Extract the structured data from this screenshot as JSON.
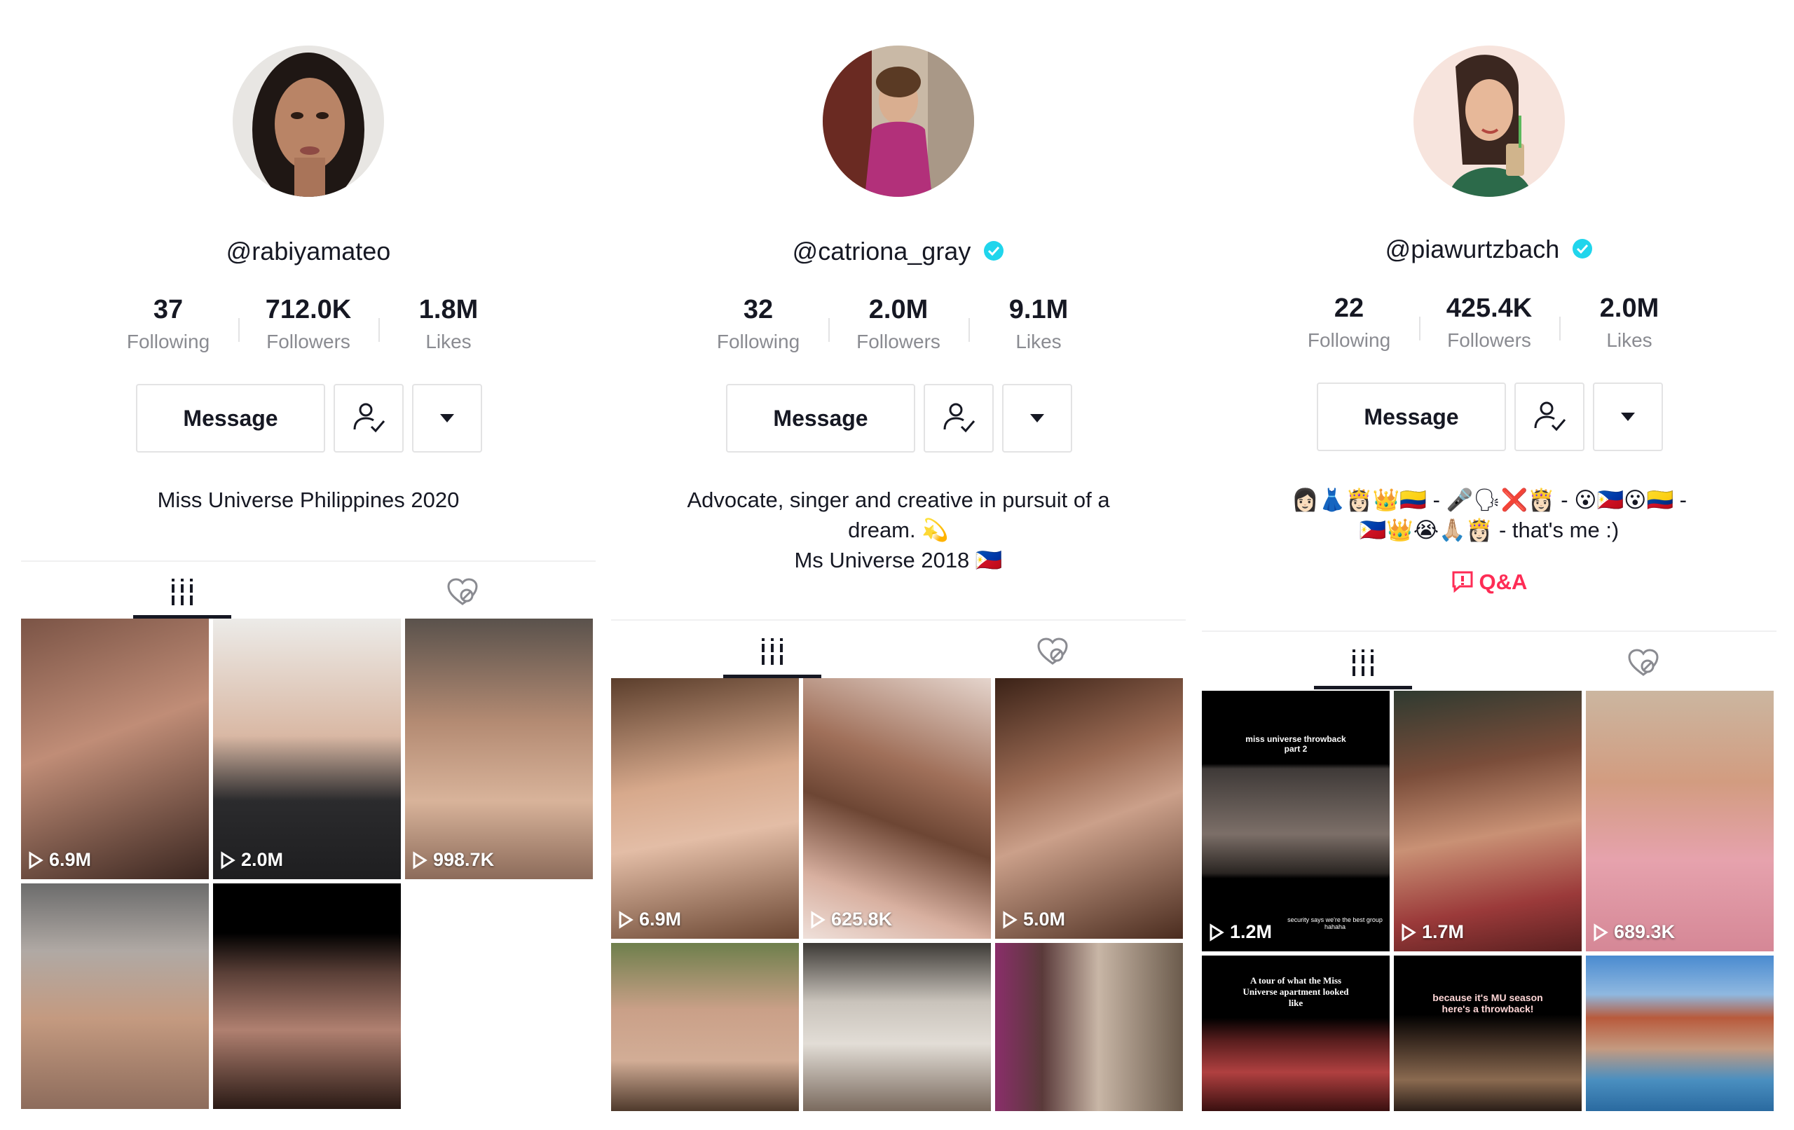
{
  "colors": {
    "text": "#161823",
    "muted": "#8a8b91",
    "accent": "#fe2c55",
    "verified": "#20d5ec"
  },
  "profiles": [
    {
      "handle": "@rabiyamateo",
      "verified": false,
      "stats": [
        {
          "value": "37",
          "label": "Following"
        },
        {
          "value": "712.0K",
          "label": "Followers"
        },
        {
          "value": "1.8M",
          "label": "Likes"
        }
      ],
      "message_label": "Message",
      "bio": [
        "Miss Universe Philippines 2020"
      ],
      "videos": [
        {
          "views": "6.9M"
        },
        {
          "views": "2.0M"
        },
        {
          "views": "998.7K"
        },
        {
          "views": ""
        },
        {
          "views": ""
        }
      ]
    },
    {
      "handle": "@catriona_gray",
      "verified": true,
      "stats": [
        {
          "value": "32",
          "label": "Following"
        },
        {
          "value": "2.0M",
          "label": "Followers"
        },
        {
          "value": "9.1M",
          "label": "Likes"
        }
      ],
      "message_label": "Message",
      "bio": [
        "Advocate, singer and creative in pursuit of a",
        "dream. 💫",
        "Ms Universe 2018 🇵🇭"
      ],
      "videos": [
        {
          "views": "6.9M"
        },
        {
          "views": "625.8K"
        },
        {
          "views": "5.0M"
        },
        {
          "views": ""
        },
        {
          "views": ""
        },
        {
          "views": ""
        }
      ]
    },
    {
      "handle": "@piawurtzbach",
      "verified": true,
      "stats": [
        {
          "value": "22",
          "label": "Following"
        },
        {
          "value": "425.4K",
          "label": "Followers"
        },
        {
          "value": "2.0M",
          "label": "Likes"
        }
      ],
      "message_label": "Message",
      "bio": [
        "👩🏻👗👸🏻👑🇨🇴 - 🎤🗣❌👸🏻 - 😮🇵🇭😮🇨🇴 -",
        "🇵🇭👑😭🙏🏼👸🏻 - that's me :)"
      ],
      "qa_label": "Q&A",
      "videos": [
        {
          "views": "1.2M",
          "top_text": "miss universe throwback part 2",
          "bottom_text": "security says we're the best group hahaha"
        },
        {
          "views": "1.7M"
        },
        {
          "views": "689.3K"
        },
        {
          "views": "",
          "top_text": "A tour of what the Miss Universe apartment looked like"
        },
        {
          "views": "",
          "top_text": "because it's MU season here's a throwback!"
        },
        {
          "views": ""
        }
      ]
    }
  ]
}
